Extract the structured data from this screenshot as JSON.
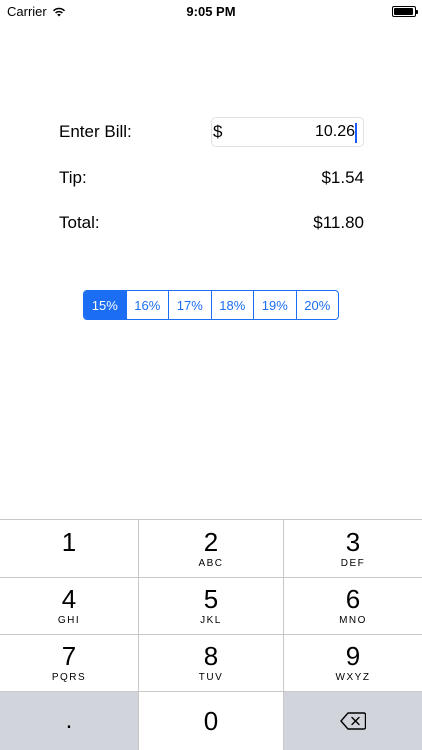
{
  "status_bar": {
    "carrier": "Carrier",
    "time": "9:05 PM"
  },
  "form": {
    "bill_label": "Enter Bill:",
    "currency_symbol": "$",
    "bill_value": "10.26",
    "tip_label": "Tip:",
    "tip_value": "$1.54",
    "total_label": "Total:",
    "total_value": "$11.80"
  },
  "tip_options": {
    "selected": "15%",
    "items": [
      "15%",
      "16%",
      "17%",
      "18%",
      "19%",
      "20%"
    ]
  },
  "keypad": {
    "keys": [
      {
        "digit": "1",
        "letters": ""
      },
      {
        "digit": "2",
        "letters": "ABC"
      },
      {
        "digit": "3",
        "letters": "DEF"
      },
      {
        "digit": "4",
        "letters": "GHI"
      },
      {
        "digit": "5",
        "letters": "JKL"
      },
      {
        "digit": "6",
        "letters": "MNO"
      },
      {
        "digit": "7",
        "letters": "PQRS"
      },
      {
        "digit": "8",
        "letters": "TUV"
      },
      {
        "digit": "9",
        "letters": "WXYZ"
      }
    ],
    "decimal": ".",
    "zero": "0",
    "delete_icon": "backspace-icon"
  },
  "colors": {
    "accent": "#1b6ef3",
    "keypad_function_bg": "#d1d5db",
    "caret": "#1a5cff"
  }
}
